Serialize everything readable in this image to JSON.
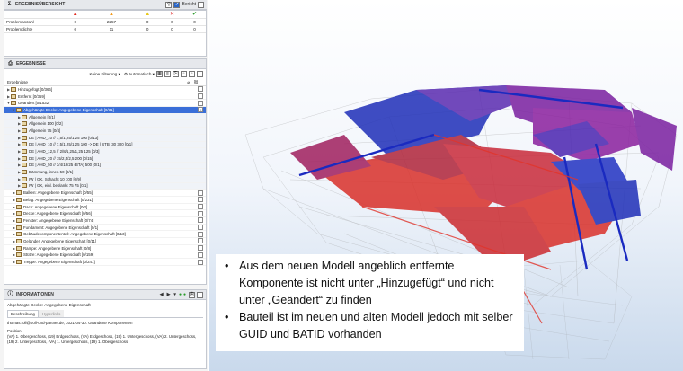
{
  "summary": {
    "title": "ERGEBNISÜBERSICHT",
    "toggle_label": "Bericht",
    "columns": [
      "▲",
      "▲",
      "▲",
      "✕",
      "✔"
    ],
    "rows": [
      {
        "label": "Problemanzahl",
        "values": [
          "0",
          "2257",
          "0",
          "0",
          "0"
        ]
      },
      {
        "label": "Problemdichte",
        "values": [
          "0",
          "11",
          "0",
          "0",
          "0"
        ]
      }
    ]
  },
  "results": {
    "title": "ERGEBNISSE",
    "filter_label": "Keine Filterung",
    "mode_label": "Automatisch",
    "tree_header": "Ergebnisse",
    "items": [
      {
        "label": "Hinzugefügt [0/366]",
        "level": 0,
        "twisty": "▶"
      },
      {
        "label": "Entfernt [0/359]",
        "level": 0,
        "twisty": "▶"
      },
      {
        "label": "Geändert [0/1532]",
        "level": 0,
        "twisty": "▼"
      },
      {
        "label": "Abgehängte Decke: Angegebene Eigenschaft [0/31]",
        "level": 1,
        "twisty": "▼",
        "selected": true
      },
      {
        "label": "Allgemein [0/1]",
        "level": 2,
        "twisty": "▶"
      },
      {
        "label": "Allgemein 100 [0/2]",
        "level": 2,
        "twisty": "▶"
      },
      {
        "label": "Allgemein 75 [0/4]",
        "level": 2,
        "twisty": "▶"
      },
      {
        "label": "DE | AHD_10 // 7,5/1,25/1,25 100 [0/13]",
        "level": 2,
        "twisty": "▶"
      },
      {
        "label": "DE | AHD_10 // 7,5/1,25/1,25 100 -> DE | STB_30 300 [0/1]",
        "level": 2,
        "twisty": "▶"
      },
      {
        "label": "DE | AHD_12,5 // 2/8/1,25/1,25 125 [0/3]",
        "level": 2,
        "twisty": "▶"
      },
      {
        "label": "DE | AHD_20 // 15/2,5/2,5 200 [0/15]",
        "level": 2,
        "twisty": "▶"
      },
      {
        "label": "DE | AHD_50 // 3/4/18/25 (BTA) 500 [0/1]",
        "level": 2,
        "twisty": "▶"
      },
      {
        "label": "Dämmung, innen 50 [0/1]",
        "level": 2,
        "twisty": "▶"
      },
      {
        "label": "IW | GK, Schacht 10 100 [0/9]",
        "level": 2,
        "twisty": "▶"
      },
      {
        "label": "IW | GK, einl. beplankt 75 75 [0/1]",
        "level": 2,
        "twisty": "▶"
      },
      {
        "label": "Balken: Angegebene Eigenschaft [0/55]",
        "level": 1,
        "twisty": "▶"
      },
      {
        "label": "Belag: Angegebene Eigenschaft [0/231]",
        "level": 1,
        "twisty": "▶"
      },
      {
        "label": "Dach: Angegebene Eigenschaft [0/2]",
        "level": 1,
        "twisty": "▶"
      },
      {
        "label": "Decke: Angegebene Eigenschaft [0/56]",
        "level": 1,
        "twisty": "▶"
      },
      {
        "label": "Fenster: Angegebene Eigenschaft [0/74]",
        "level": 1,
        "twisty": "▶"
      },
      {
        "label": "Fundament: Angegebene Eigenschaft [0/1]",
        "level": 1,
        "twisty": "▶"
      },
      {
        "label": "Gebäudekomponententeil: Angegebene Eigenschaft [0/13]",
        "level": 1,
        "twisty": "▶"
      },
      {
        "label": "Geländer: Angegebene Eigenschaft [0/11]",
        "level": 1,
        "twisty": "▶"
      },
      {
        "label": "Rampe: Angegebene Eigenschaft [0/8]",
        "level": 1,
        "twisty": "▶"
      },
      {
        "label": "Stütze: Angegebene Eigenschaft [0/159]",
        "level": 1,
        "twisty": "▶"
      },
      {
        "label": "Treppe: Angegebene Eigenschaft [0/241]",
        "level": 1,
        "twisty": "▶"
      }
    ]
  },
  "info": {
    "title": "INFORMATIONEN",
    "subtitle": "Abgehängte Decke: Angegebene Eigenschaft",
    "tab_description": "Beschreibung",
    "tab_hyperlinks": "Hyperlinks",
    "author_line": "thomas.roll@boll-und-partner.de, 2021-04-30: Geänderte Komponenten",
    "position_label": "Position:",
    "position_text": "(VA) 1. Obergeschoss, (19) Erdgeschoss, (VA) Erdgeschoss, (19) 1. Untergeschoss, (VA) 2. Untergeschoss, (19) 2. Untergeschoss, (VA) 1. Untergeschoss, (19) 1. Obergeschoss"
  },
  "callout": {
    "bullets": [
      "Aus dem neuen Modell angeblich entfernte Komponente ist nicht unter „Hinzugefügt“ und nicht unter „Geändert“ zu finden",
      "Bauteil ist im neuen und alten Modell jedoch mit selber GUID und BATID vorhanden"
    ]
  },
  "colors": {
    "selection": "#3b6fd8",
    "model_red": "#d9302a",
    "model_blue": "#1f2fb8",
    "model_purple": "#7a1fa0"
  }
}
